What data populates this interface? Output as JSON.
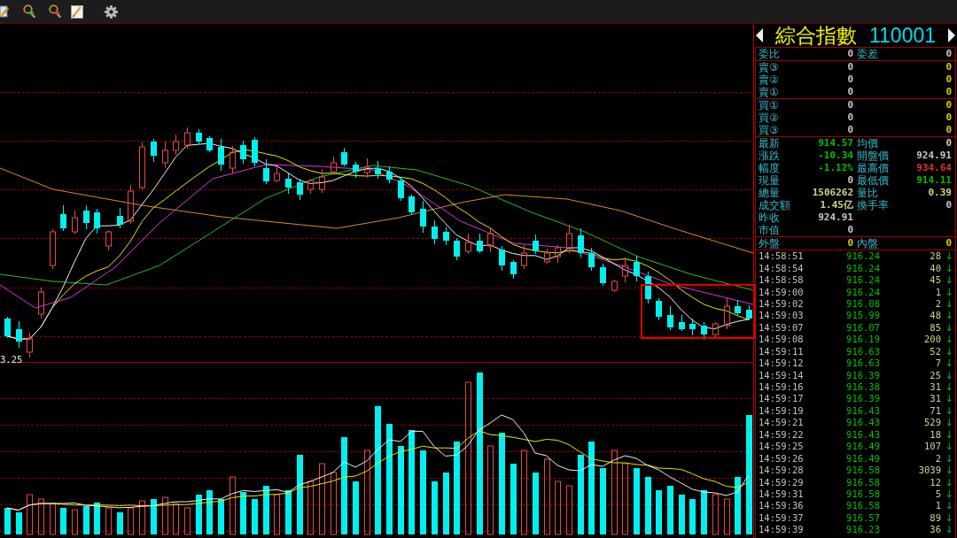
{
  "chart": {
    "low_label": "3.25"
  },
  "quote_panel": {
    "name": "綜合指數",
    "code": "110001",
    "committee": {
      "cells": [
        {
          "label": "委比",
          "value": "0",
          "color": "#c8c8c8"
        },
        {
          "label": "委差",
          "value": "0",
          "color": "#c8c8c8"
        }
      ]
    },
    "asks": [
      {
        "label": "賣③",
        "price": "0",
        "volume": "0"
      },
      {
        "label": "賣②",
        "price": "0",
        "volume": "0"
      },
      {
        "label": "賣①",
        "price": "0",
        "volume": "0"
      }
    ],
    "bids": [
      {
        "label": "買①",
        "price": "0",
        "volume": "0"
      },
      {
        "label": "買②",
        "price": "0",
        "volume": "0"
      },
      {
        "label": "買③",
        "price": "0",
        "volume": "0"
      }
    ],
    "stats": [
      {
        "cells": [
          {
            "label": "最新",
            "value": "914.57",
            "color": "#00c000"
          },
          {
            "label": "均價",
            "value": "0",
            "color": "#c8c8c8"
          }
        ]
      },
      {
        "cells": [
          {
            "label": "漲跌",
            "value": "-10.34",
            "color": "#00c000"
          },
          {
            "label": "開盤價",
            "value": "924.91",
            "color": "#c8c8c8"
          }
        ]
      },
      {
        "cells": [
          {
            "label": "幅度",
            "value": "-1.12%",
            "color": "#00c000"
          },
          {
            "label": "最高價",
            "value": "934.64",
            "color": "#e03030"
          }
        ]
      },
      {
        "cells": [
          {
            "label": "現量",
            "value": "0",
            "color": "#c8c8c8"
          },
          {
            "label": "最低價",
            "value": "914.11",
            "color": "#00c000"
          }
        ]
      },
      {
        "cells": [
          {
            "label": "總量",
            "value": "1506262",
            "color": "#d2d28c"
          },
          {
            "label": "量比",
            "value": "0.39",
            "color": "#d2d28c"
          }
        ]
      },
      {
        "cells": [
          {
            "label": "成交額",
            "value": "1.45亿",
            "color": "#d2d28c"
          },
          {
            "label": "換手率",
            "value": "0",
            "color": "#c8c8c8"
          }
        ]
      },
      {
        "cells": [
          {
            "label": "昨收",
            "value": "924.91",
            "color": "#c8c8c8"
          }
        ]
      },
      {
        "cells": [
          {
            "label": "市值",
            "value": "0",
            "color": "#c8c8c8"
          }
        ]
      }
    ],
    "trade_side": {
      "cells": [
        {
          "label": "外盤",
          "value": "0",
          "color": "#d0d000"
        },
        {
          "label": "內盤",
          "value": "0",
          "color": "#d0d000"
        }
      ]
    }
  },
  "ticks": [
    {
      "time": "14:58:51",
      "price": "916.24",
      "volume": "28",
      "arrow": "↓"
    },
    {
      "time": "14:58:54",
      "price": "916.24",
      "volume": "40",
      "arrow": "↓"
    },
    {
      "time": "14:58:58",
      "price": "916.24",
      "volume": "45",
      "arrow": "↓"
    },
    {
      "time": "14:59:00",
      "price": "916.24",
      "volume": "1",
      "arrow": "↓"
    },
    {
      "time": "14:59:02",
      "price": "916.08",
      "volume": "2",
      "arrow": "↓"
    },
    {
      "time": "14:59:03",
      "price": "915.99",
      "volume": "48",
      "arrow": "↓"
    },
    {
      "time": "14:59:07",
      "price": "916.07",
      "volume": "85",
      "arrow": "↓"
    },
    {
      "time": "14:59:08",
      "price": "916.19",
      "volume": "200",
      "arrow": "↓"
    },
    {
      "time": "14:59:11",
      "price": "916.63",
      "volume": "52",
      "arrow": "↓"
    },
    {
      "time": "14:59:12",
      "price": "916.63",
      "volume": "7",
      "arrow": "↓"
    },
    {
      "time": "14:59:14",
      "price": "916.39",
      "volume": "25",
      "arrow": "↓"
    },
    {
      "time": "14:59:16",
      "price": "916.38",
      "volume": "31",
      "arrow": "↓"
    },
    {
      "time": "14:59:17",
      "price": "916.39",
      "volume": "31",
      "arrow": "↓"
    },
    {
      "time": "14:59:19",
      "price": "916.43",
      "volume": "71",
      "arrow": "↓"
    },
    {
      "time": "14:59:21",
      "price": "916.43",
      "volume": "529",
      "arrow": "↓"
    },
    {
      "time": "14:59:22",
      "price": "916.43",
      "volume": "18",
      "arrow": "↓"
    },
    {
      "time": "14:59:25",
      "price": "916.49",
      "volume": "107",
      "arrow": "↓"
    },
    {
      "time": "14:59:26",
      "price": "916.49",
      "volume": "2",
      "arrow": "↓"
    },
    {
      "time": "14:59:28",
      "price": "916.58",
      "volume": "3039",
      "arrow": "↓"
    },
    {
      "time": "14:59:29",
      "price": "916.58",
      "volume": "12",
      "arrow": "↓"
    },
    {
      "time": "14:59:31",
      "price": "916.58",
      "volume": "5",
      "arrow": "↓"
    },
    {
      "time": "14:59:36",
      "price": "916.58",
      "volume": "1",
      "arrow": "↓"
    },
    {
      "time": "14:59:37",
      "price": "916.57",
      "volume": "89",
      "arrow": "↓"
    },
    {
      "time": "14:59:39",
      "price": "916.23",
      "volume": "36",
      "arrow": "↓"
    }
  ]
}
